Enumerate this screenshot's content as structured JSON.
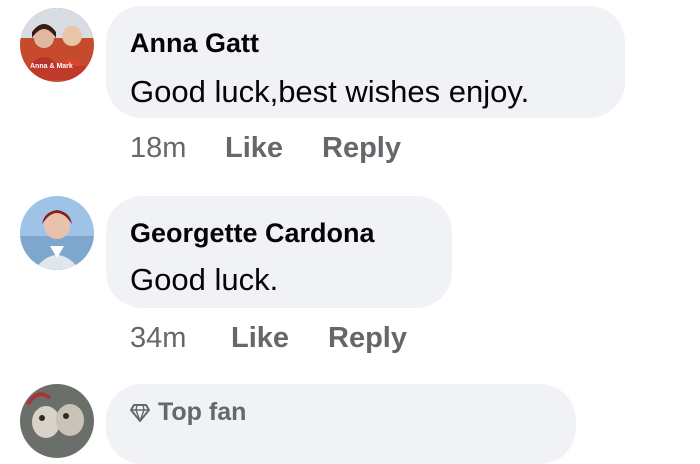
{
  "comments": [
    {
      "author": "Anna Gatt",
      "text": "Good luck,best wishes enjoy.",
      "time": "18m",
      "like_label": "Like",
      "reply_label": "Reply",
      "avatar_caption": "Anna & Mark"
    },
    {
      "author": "Georgette Cardona",
      "text": "Good luck.",
      "time": "34m",
      "like_label": "Like",
      "reply_label": "Reply"
    },
    {
      "badge_icon": "diamond-icon",
      "badge_label": "Top fan"
    }
  ],
  "colors": {
    "bubble": "#f0f2f5",
    "meta_text": "#65676b",
    "primary_text": "#050505"
  }
}
